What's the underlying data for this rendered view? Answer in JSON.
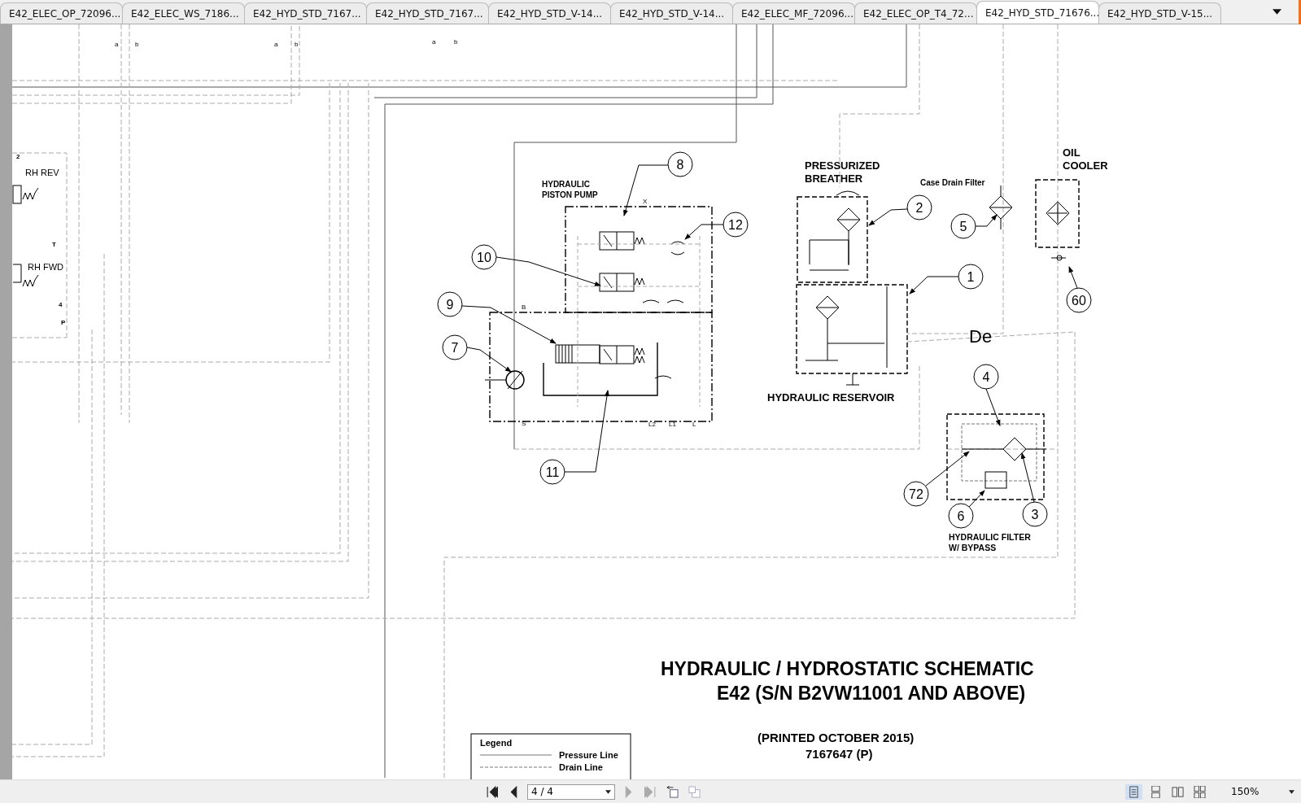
{
  "tabs": [
    {
      "label": "E42_ELEC_OP_72096...",
      "selected": false
    },
    {
      "label": "E42_ELEC_WS_7186...",
      "selected": false
    },
    {
      "label": "E42_HYD_STD_7167...",
      "selected": false
    },
    {
      "label": "E42_HYD_STD_7167...",
      "selected": false
    },
    {
      "label": "E42_HYD_STD_V-14...",
      "selected": false
    },
    {
      "label": "E42_HYD_STD_V-14...",
      "selected": false
    },
    {
      "label": "E42_ELEC_MF_72096...",
      "selected": false
    },
    {
      "label": "E42_ELEC_OP_T4_72...",
      "selected": false
    },
    {
      "label": "E42_HYD_STD_71676...",
      "selected": true
    },
    {
      "label": "E42_HYD_STD_V-15...",
      "selected": false
    }
  ],
  "schematic": {
    "pin_labels": [
      "a",
      "b",
      "a",
      "b",
      "a",
      "b",
      "2",
      "T",
      "4",
      "P",
      "X",
      "B",
      "S",
      "L2",
      "L1",
      "L"
    ],
    "component_labels": [
      {
        "lines": [
          "RH REV"
        ]
      },
      {
        "lines": [
          "RH FWD"
        ]
      },
      {
        "lines": [
          "HYDRAULIC",
          "PISTON PUMP"
        ]
      },
      {
        "lines": [
          "PRESSURIZED",
          "BREATHER"
        ]
      },
      {
        "lines": [
          "Case Drain Filter"
        ]
      },
      {
        "lines": [
          "OIL",
          "COOLER"
        ]
      },
      {
        "lines": [
          "HYDRAULIC RESERVOIR"
        ]
      },
      {
        "lines": [
          "HYDRAULIC FILTER",
          "W/ BYPASS"
        ]
      }
    ],
    "callouts": [
      {
        "number": "8"
      },
      {
        "number": "12"
      },
      {
        "number": "10"
      },
      {
        "number": "9"
      },
      {
        "number": "7"
      },
      {
        "number": "11"
      },
      {
        "number": "2"
      },
      {
        "number": "1"
      },
      {
        "number": "5"
      },
      {
        "number": "60"
      },
      {
        "number": "4"
      },
      {
        "number": "72"
      },
      {
        "number": "6"
      },
      {
        "number": "3"
      }
    ],
    "stray_text": "De",
    "title": [
      "HYDRAULIC / HYDROSTATIC SCHEMATIC",
      "E42 (S/N B2VW11001 AND ABOVE)"
    ],
    "printed": [
      "(PRINTED OCTOBER 2015)",
      "7167647 (P)"
    ],
    "legend": {
      "title": "Legend",
      "entries": [
        {
          "label": "Pressure Line",
          "kind": "solid"
        },
        {
          "label": "Drain Line",
          "kind": "dashed"
        }
      ]
    }
  },
  "toolbar": {
    "nav": [
      {
        "kind": "first",
        "disabled": false
      },
      {
        "kind": "prev",
        "disabled": false
      },
      {
        "kind": "next",
        "disabled": true
      },
      {
        "kind": "last",
        "disabled": true
      }
    ],
    "page": "4 / 4",
    "views": [
      {
        "kind": "single",
        "selected": true
      },
      {
        "kind": "continuous",
        "selected": false
      },
      {
        "kind": "facing",
        "selected": false
      },
      {
        "kind": "facing-continuous",
        "selected": false
      }
    ],
    "zoom": "150%"
  }
}
